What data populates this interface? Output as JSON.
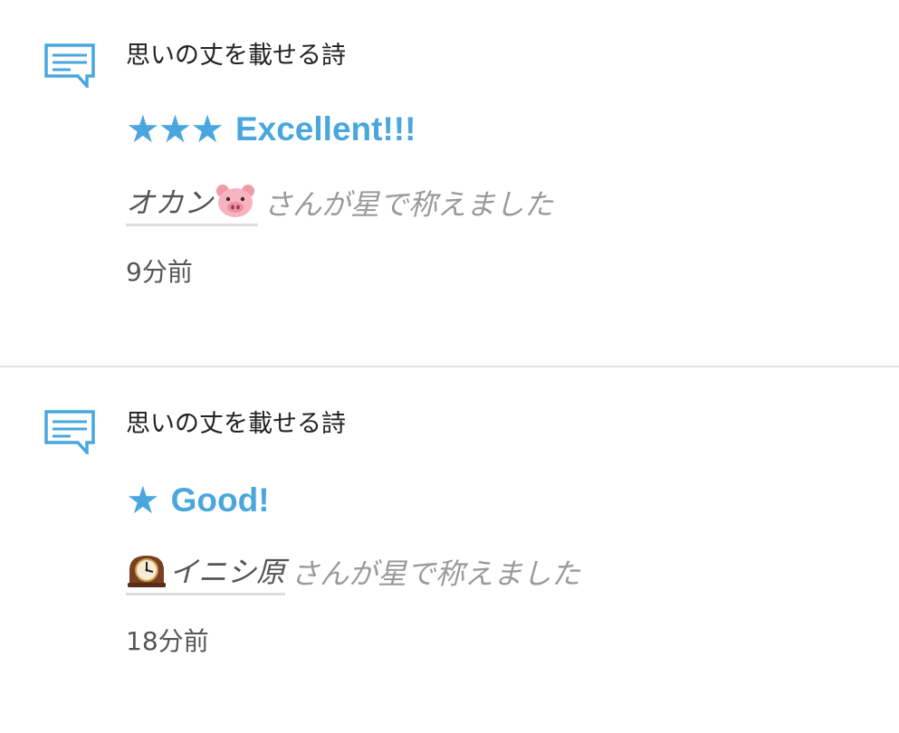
{
  "notifications": [
    {
      "icon": "comment-icon",
      "title": "思いの丈を載せる詩",
      "stars": "★★★",
      "rating_label": "Excellent!!!",
      "actor_name": "オカン",
      "actor_emoji": "pig-face-emoji",
      "actor_suffix": "さんが星で称えました",
      "time": "9分前"
    },
    {
      "icon": "comment-icon",
      "title": "思いの丈を載せる詩",
      "stars": "★",
      "rating_label": "Good!",
      "actor_name": "イニシ原",
      "actor_emoji": "mantelpiece-clock-emoji",
      "actor_suffix": "さんが星で称えました",
      "time": "18分前"
    }
  ],
  "colors": {
    "accent": "#4aa7de",
    "title_text": "#222222",
    "secondary_text": "#9a9a9a",
    "divider": "#e2e2e2"
  }
}
